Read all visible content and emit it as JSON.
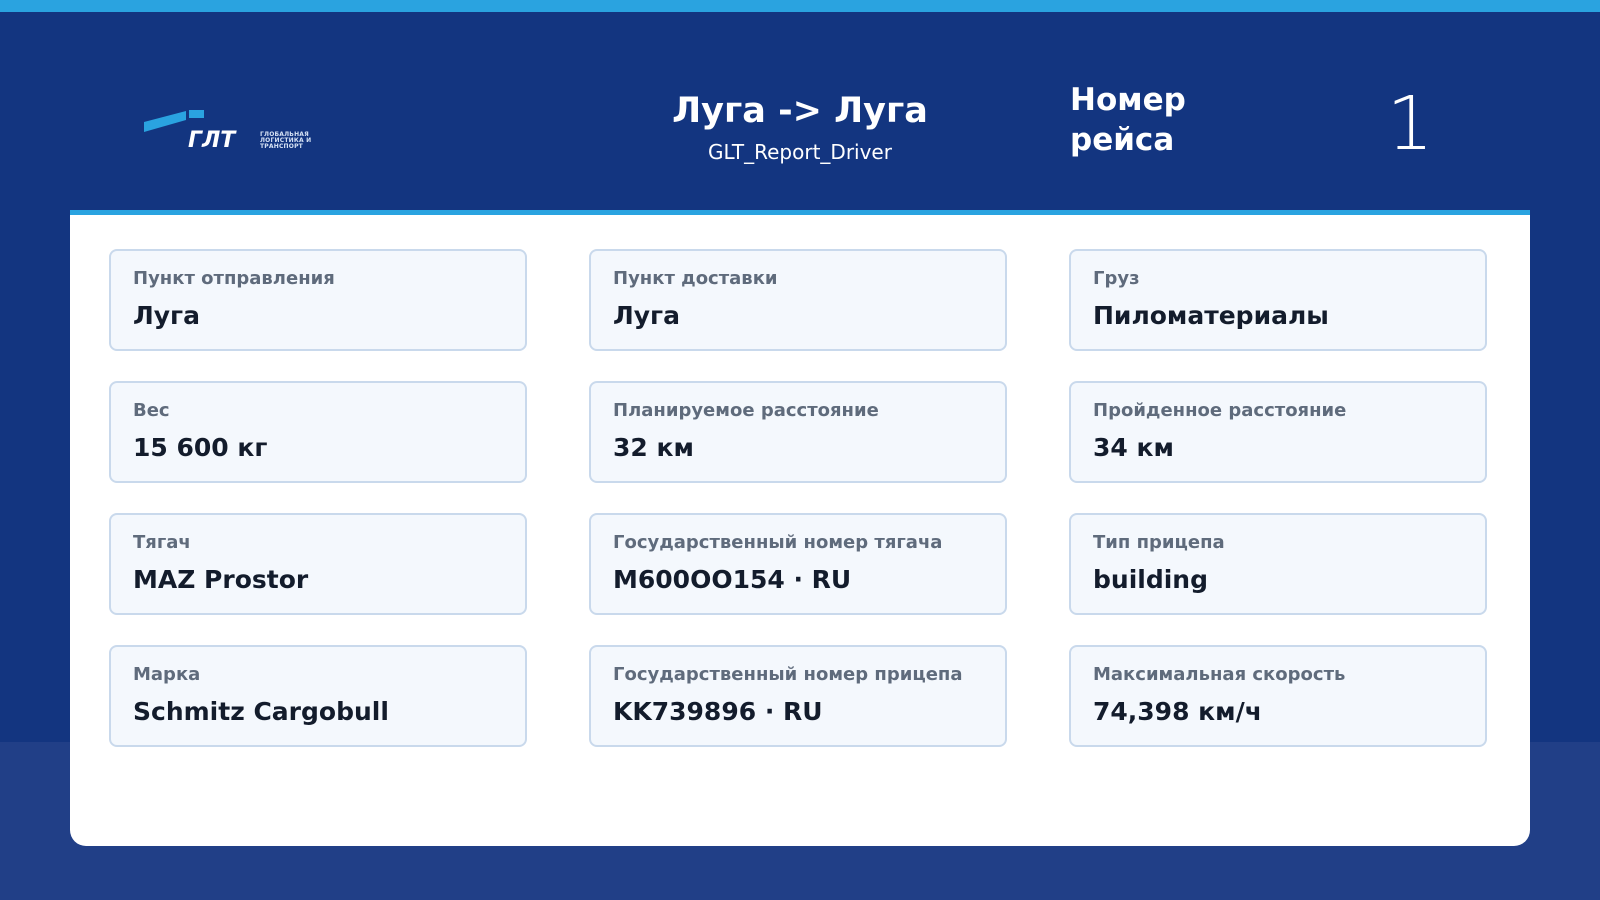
{
  "header": {
    "route_title": "Луга -> Луга",
    "report_name": "GLT_Report_Driver",
    "trip_label": "Номер рейса",
    "trip_number": "1",
    "logo": {
      "abbr": "ГЛТ",
      "tagline_lines": [
        "ГЛОБАЛЬНАЯ",
        "ЛОГИСТИКА И",
        "ТРАНСПОРТ"
      ]
    }
  },
  "cards": [
    {
      "label": "Пункт отправления",
      "value": "Луга"
    },
    {
      "label": "Пункт доставки",
      "value": "Луга"
    },
    {
      "label": "Груз",
      "value": "Пиломатериалы"
    },
    {
      "label": "Вес",
      "value": "15 600 кг"
    },
    {
      "label": "Планируемое расстояние",
      "value": "32 км"
    },
    {
      "label": "Пройденное расстояние",
      "value": "34 км"
    },
    {
      "label": "Тягач",
      "value": "MAZ Prostor"
    },
    {
      "label": "Государственный номер тягача",
      "value": "M600OO154 · RU"
    },
    {
      "label": "Тип прицепа",
      "value": "building"
    },
    {
      "label": "Марка",
      "value": "Schmitz Cargobull"
    },
    {
      "label": "Государственный номер прицепа",
      "value": "KK739896 · RU"
    },
    {
      "label": "Максимальная скорость",
      "value": "74,398 км/ч"
    }
  ],
  "colors": {
    "accent": "#2aa3e0",
    "header_bg": "#133580",
    "footer_bg": "#213f87",
    "card_bg": "#f4f8fd",
    "card_border": "#c9d9ec",
    "label_text": "#5f6b7c",
    "value_text": "#131c2c"
  }
}
